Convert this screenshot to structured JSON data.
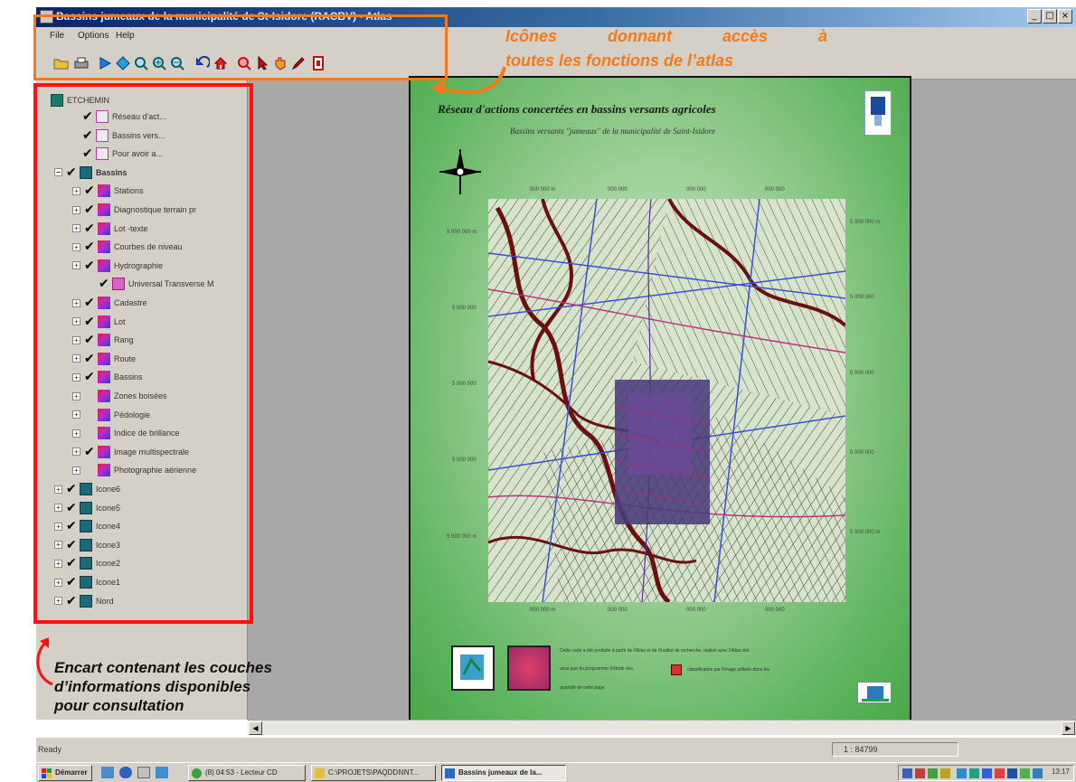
{
  "window": {
    "title": "Bassins jumeaux de la municipalité de St-Isidore (RACBV) - Atlas"
  },
  "menu": {
    "items": [
      "File",
      "Options",
      "Help"
    ]
  },
  "toolbar_icons": [
    "open-folder-icon",
    "print-icon",
    "play-icon",
    "move-icon",
    "zoom-fit-icon",
    "zoom-in-icon",
    "zoom-out-icon",
    "back-icon",
    "home-icon",
    "find-icon",
    "pointer-icon",
    "hand-icon",
    "pen-icon",
    "exit-icon"
  ],
  "annotations": {
    "toolbar_line1": [
      "Icônes",
      "donnant",
      "accès",
      "à"
    ],
    "toolbar_line2": "toutes les fonctions de l’atlas",
    "panel": [
      "Encart contenant les couches",
      "d’informations disponibles",
      "pour consultation"
    ]
  },
  "layers": {
    "root": "ETCHEMIN",
    "items": [
      {
        "label": "Réseau d'act...",
        "icon": "document-icon",
        "checked": true,
        "indent": 1,
        "expander": ""
      },
      {
        "label": "Bassins vers...",
        "icon": "document-icon",
        "checked": true,
        "indent": 1,
        "expander": ""
      },
      {
        "label": "Pour avoir a...",
        "icon": "document-icon",
        "checked": true,
        "indent": 1,
        "expander": ""
      },
      {
        "label": "Bassins",
        "icon": "group-icon",
        "checked": true,
        "indent": 0,
        "expander": "−",
        "bold": true
      },
      {
        "label": "Stations",
        "icon": "raster-icon",
        "checked": true,
        "indent": 2,
        "expander": "+"
      },
      {
        "label": "Diagnostique terrain pr",
        "icon": "raster-icon",
        "checked": true,
        "indent": 2,
        "expander": "+"
      },
      {
        "label": "Lot -texte",
        "icon": "raster-icon",
        "checked": true,
        "indent": 2,
        "expander": "+"
      },
      {
        "label": "Courbes de niveau",
        "icon": "raster-icon",
        "checked": true,
        "indent": 2,
        "expander": "+"
      },
      {
        "label": "Hydrographie",
        "icon": "raster-icon",
        "checked": true,
        "indent": 2,
        "expander": "+"
      },
      {
        "label": "Universal Transverse M",
        "icon": "utm-icon",
        "checked": true,
        "indent": 3,
        "expander": ""
      },
      {
        "label": "Cadastre",
        "icon": "raster-icon",
        "checked": true,
        "indent": 2,
        "expander": "+"
      },
      {
        "label": "Lot",
        "icon": "raster-icon",
        "checked": true,
        "indent": 2,
        "expander": "+"
      },
      {
        "label": "Rang",
        "icon": "raster-icon",
        "checked": true,
        "indent": 2,
        "expander": "+"
      },
      {
        "label": "Route",
        "icon": "raster-icon",
        "checked": true,
        "indent": 2,
        "expander": "+"
      },
      {
        "label": "Bassins",
        "icon": "raster-icon",
        "checked": true,
        "indent": 2,
        "expander": "+"
      },
      {
        "label": "Zones boisées",
        "icon": "raster-icon",
        "checked": false,
        "indent": 2,
        "expander": "+"
      },
      {
        "label": "Pédologie",
        "icon": "raster-icon",
        "checked": false,
        "indent": 2,
        "expander": "+"
      },
      {
        "label": "Indice de brillance",
        "icon": "raster-icon",
        "checked": false,
        "indent": 2,
        "expander": "+"
      },
      {
        "label": "Image multispectrale",
        "icon": "raster-icon",
        "checked": true,
        "indent": 2,
        "expander": "+"
      },
      {
        "label": "Photographie aérienne",
        "icon": "raster-icon",
        "checked": false,
        "indent": 2,
        "expander": "+"
      },
      {
        "label": "Icone6",
        "icon": "group-icon",
        "checked": true,
        "indent": 0,
        "expander": "+"
      },
      {
        "label": "Icone5",
        "icon": "group-icon",
        "checked": true,
        "indent": 0,
        "expander": "+"
      },
      {
        "label": "Icone4",
        "icon": "group-icon",
        "checked": true,
        "indent": 0,
        "expander": "+"
      },
      {
        "label": "Icone3",
        "icon": "group-icon",
        "checked": true,
        "indent": 0,
        "expander": "+"
      },
      {
        "label": "Icone2",
        "icon": "group-icon",
        "checked": true,
        "indent": 0,
        "expander": "+"
      },
      {
        "label": "Icone1",
        "icon": "group-icon",
        "checked": true,
        "indent": 0,
        "expander": "+"
      },
      {
        "label": "Nord",
        "icon": "group-icon",
        "checked": true,
        "indent": 0,
        "expander": "+"
      }
    ]
  },
  "map": {
    "title": "Réseau d'actions concertées en bassins versants agricoles",
    "subtitle": "Bassins versants \"jumeaux\" de la municipalité de Saint-Isidore",
    "coords_top": [
      "000 000 m",
      "000 000",
      "000 000",
      "000 000"
    ],
    "coords_bottom": [
      "000 000 m",
      "000 000",
      "000 000",
      "000 000"
    ],
    "coords_left": [
      "5 000 000 m",
      "5 000 000",
      "5 000 000",
      "5 000 000",
      "5 000 000 m"
    ],
    "coords_right": [
      "5 000 000 m",
      "5 000 000",
      "5 000 000",
      "5 000 000",
      "5 000 000 m"
    ],
    "legend": {
      "line1": "Cette carte a été produite à partir de l'Atlas et de l'Institut de recherche, réalisé avec l'Atlas cité",
      "line2": "ainsi que du programme d'étude des",
      "line3": "classification par l'image utilisée dans les",
      "line4": "quantité de cette page"
    }
  },
  "status": {
    "text": "Ready",
    "scale": "1 : 84799"
  },
  "taskbar": {
    "start": "Démarrer",
    "tasks": [
      "(8) 04:53 - Lecteur CD",
      "C:\\PROJETS\\PAQDDI\\INT...",
      "Bassins jumeaux de la..."
    ],
    "clock": "13:17"
  },
  "colors": {
    "orange": "#f07a1c",
    "red": "#ff1010",
    "map_green": "#5fb55f"
  }
}
